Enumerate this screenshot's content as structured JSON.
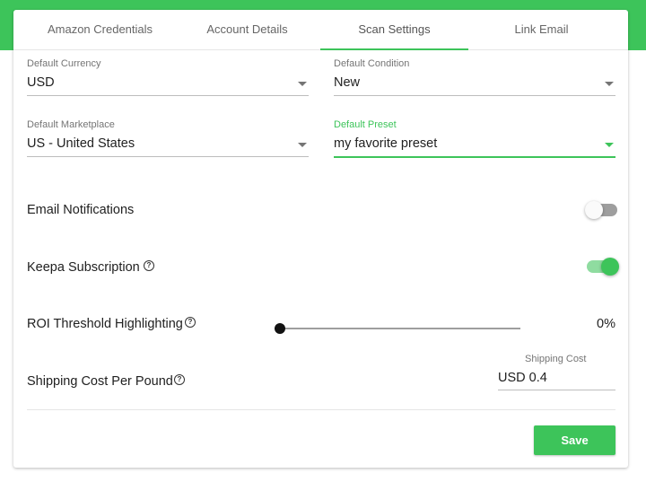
{
  "tabs": [
    {
      "label": "Amazon Credentials"
    },
    {
      "label": "Account Details"
    },
    {
      "label": "Scan Settings"
    },
    {
      "label": "Link Email"
    }
  ],
  "fields": {
    "currency": {
      "label": "Default Currency",
      "value": "USD"
    },
    "condition": {
      "label": "Default Condition",
      "value": "New"
    },
    "marketplace": {
      "label": "Default Marketplace",
      "value": "US - United States"
    },
    "preset": {
      "label": "Default Preset",
      "value": "my favorite preset"
    }
  },
  "settings": {
    "email_notifications": {
      "label": "Email Notifications",
      "enabled": false
    },
    "keepa_subscription": {
      "label": "Keepa Subscription",
      "enabled": true
    },
    "roi_threshold": {
      "label": "ROI Threshold Highlighting",
      "value_text": "0%",
      "value": 0
    },
    "shipping_cost": {
      "label": "Shipping Cost Per Pound",
      "input_label": "Shipping Cost",
      "value": "USD 0.4"
    }
  },
  "help_glyph": "?",
  "save_label": "Save",
  "colors": {
    "accent": "#3dc45a",
    "toggle_off": "#9e9e9e"
  }
}
